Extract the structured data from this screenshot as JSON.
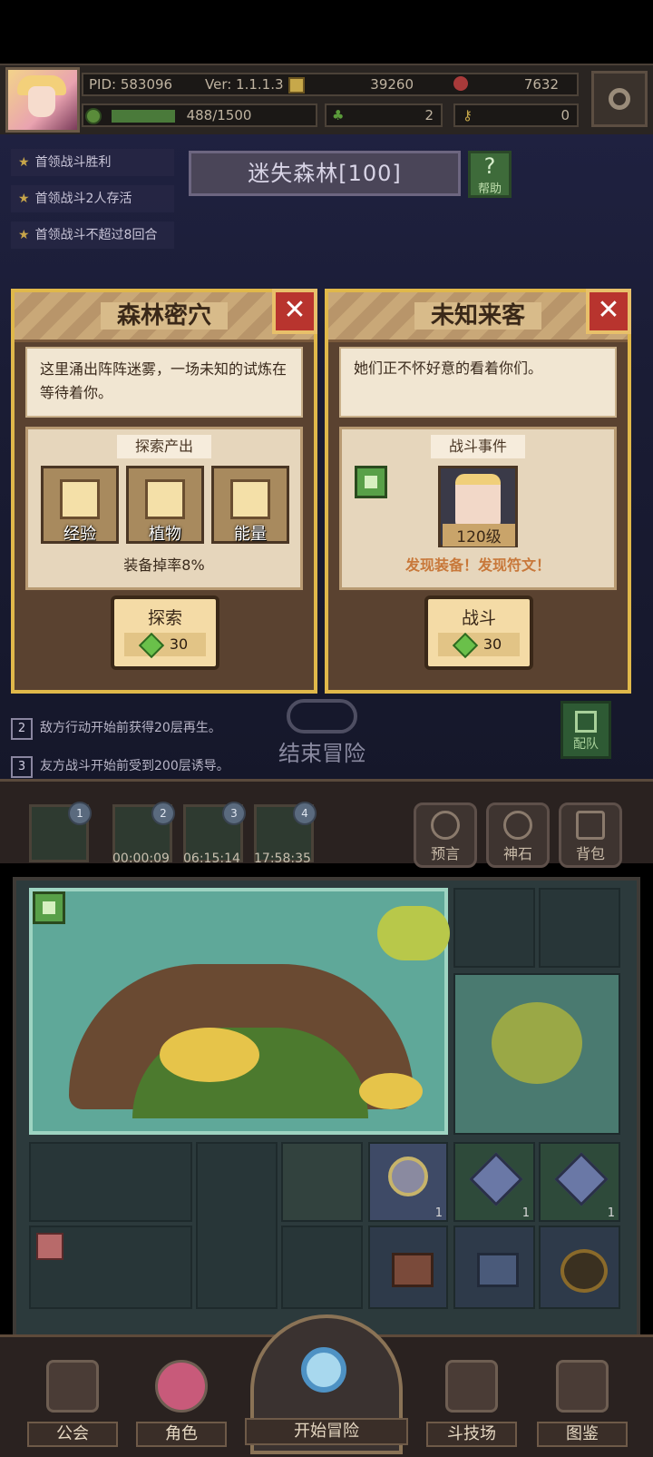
{
  "header": {
    "pid": "PID: 583096",
    "version": "Ver: 1.1.1.3",
    "gold": "39260",
    "red": "7632",
    "energy": "488/1500",
    "clover": "2",
    "key": "0"
  },
  "quests": [
    "首领战斗胜利",
    "首领战斗2人存活",
    "首领战斗不超过8回合"
  ],
  "location": {
    "title": "迷失森林[100]",
    "help": "帮助"
  },
  "panel_left": {
    "title": "森林密穴",
    "desc": "这里涌出阵阵迷雾，一场未知的试炼在等待着你。",
    "section_title": "探索产出",
    "items": [
      "经验",
      "植物",
      "能量"
    ],
    "drop": "装备掉率8%",
    "button": "探索",
    "cost": "30"
  },
  "panel_right": {
    "title": "未知来客",
    "desc": "她们正不怀好意的看着你们。",
    "section_title": "战斗事件",
    "level": "120级",
    "reward": "发现装备！发现符文！",
    "button": "战斗",
    "cost": "30"
  },
  "rules": [
    {
      "n": "2",
      "text": "敌方行动开始前获得20层再生。"
    },
    {
      "n": "3",
      "text": "友方战斗开始前受到200层诱导。"
    }
  ],
  "end_button": "结束冒险",
  "formation": "配队",
  "slots": [
    {
      "n": "1",
      "timer": ""
    },
    {
      "n": "2",
      "timer": "00:00:09"
    },
    {
      "n": "3",
      "timer": "06:15:14"
    },
    {
      "n": "4",
      "timer": "17:58:35"
    }
  ],
  "side_buttons": [
    "预言",
    "神石",
    "背包"
  ],
  "grid_qty": [
    "1",
    "1",
    "1"
  ],
  "nav": [
    "公会",
    "角色",
    "开始冒险",
    "斗技场",
    "图鉴"
  ]
}
